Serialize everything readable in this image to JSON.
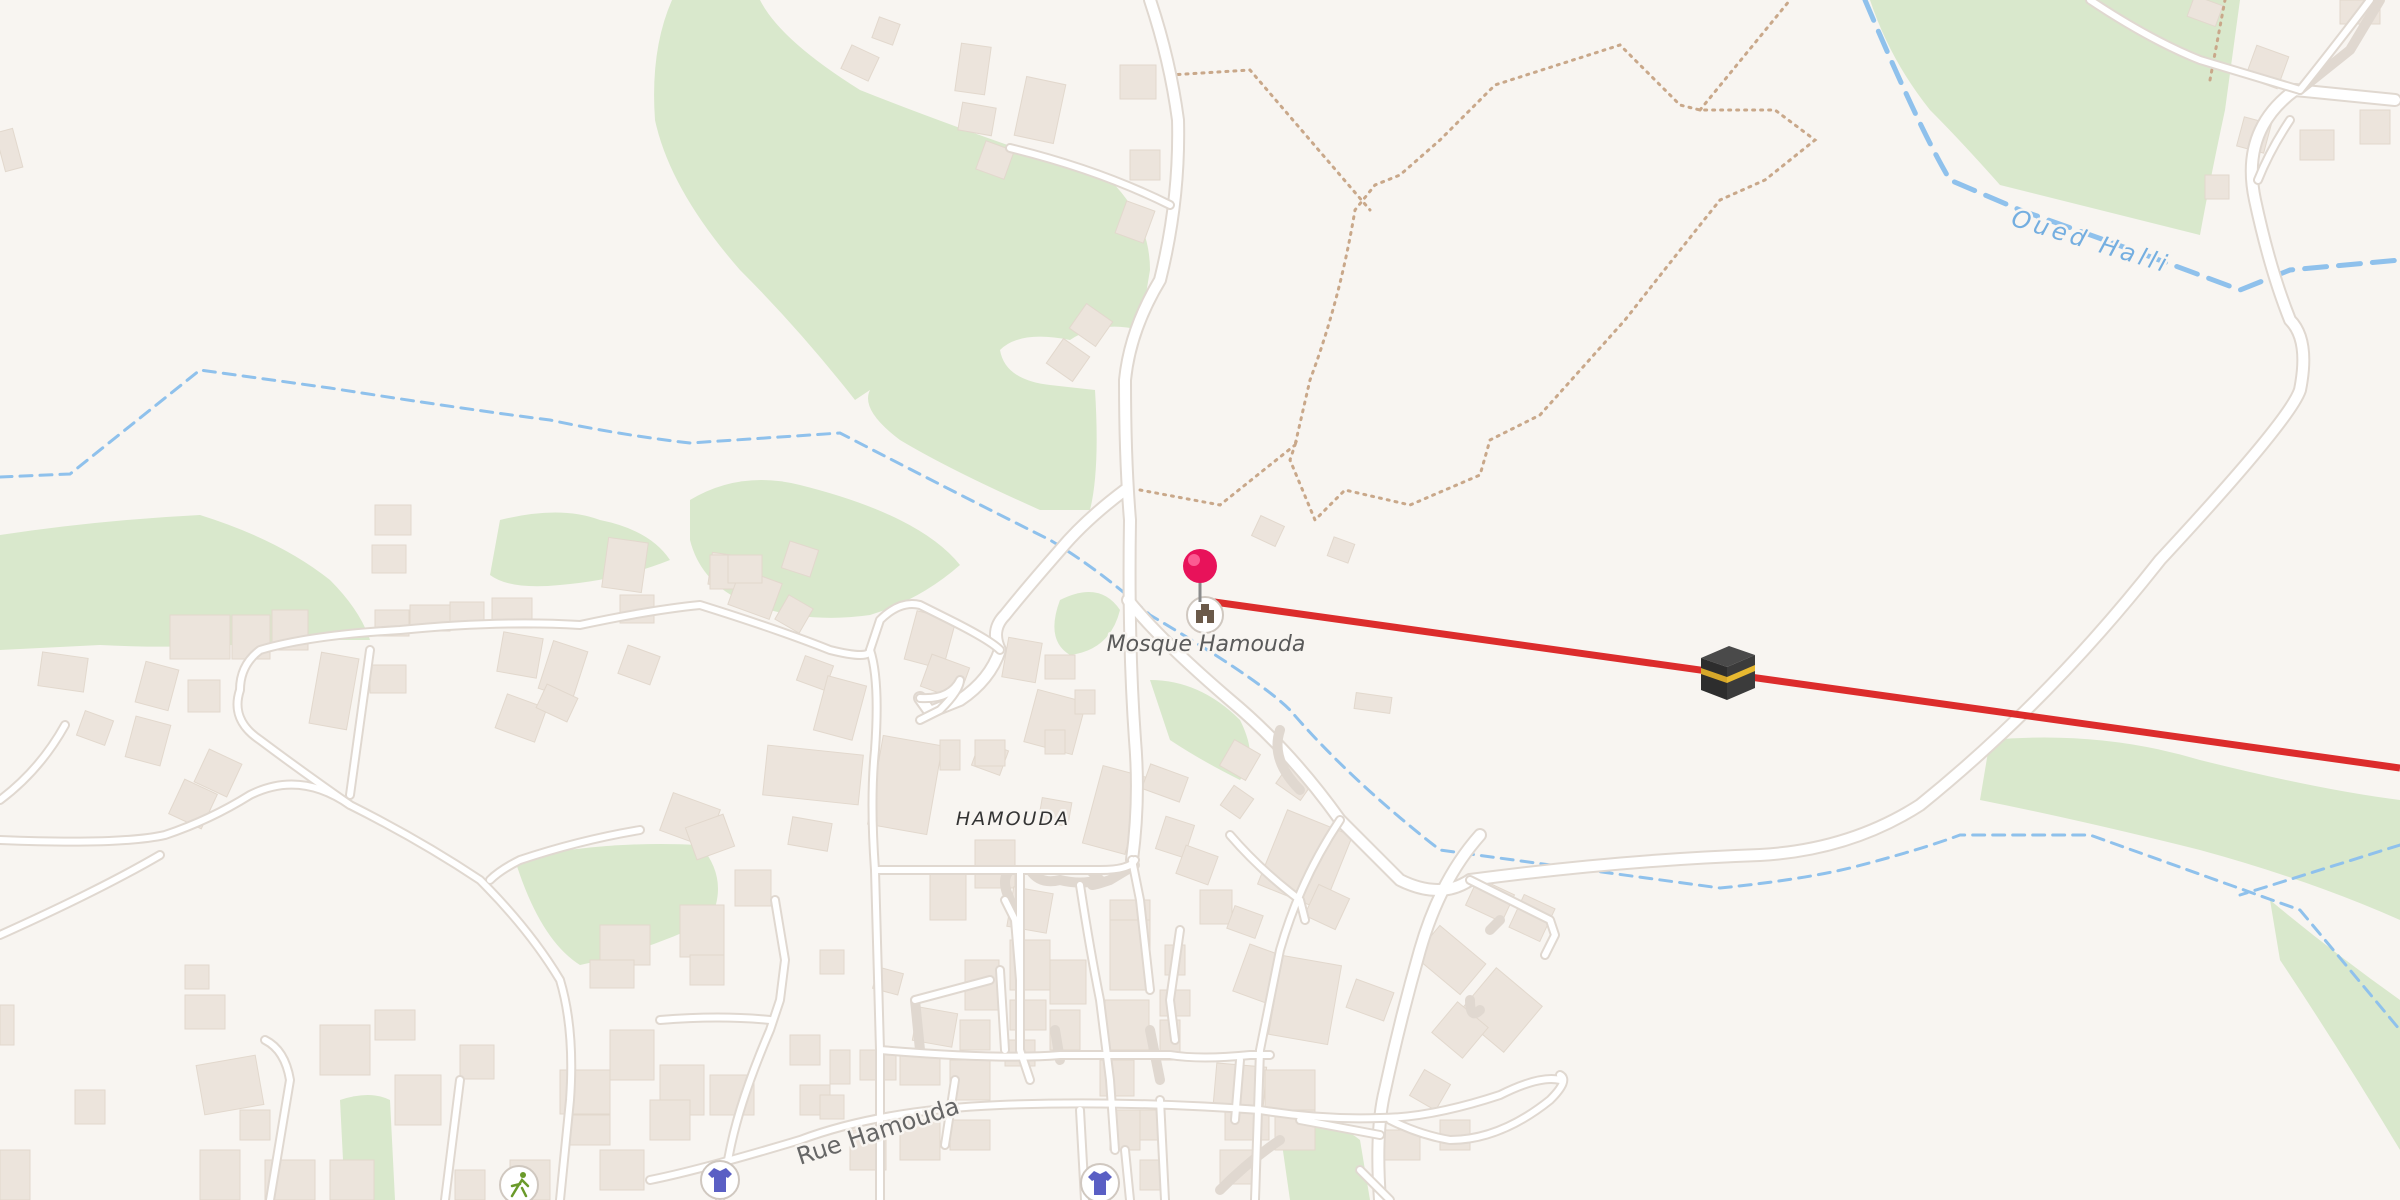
{
  "map": {
    "poi_label": "Mosque Hamouda",
    "poi_icon": "mosque-icon",
    "place_label": "HAMOUDA",
    "road_label": "Rue Hamouda",
    "waterway_label": "Oued Halli",
    "marker_icon": "location-pin-icon",
    "qibla_icon": "kaaba-icon",
    "line_description": "Qibla direction line",
    "poi_icons": [
      "clothing-shop-icon",
      "clothing-shop-icon",
      "sports-icon"
    ]
  },
  "colors": {
    "background": "#f8f5f1",
    "park": "#d9e8cc",
    "building": "#ece4dc",
    "road": "#ffffff",
    "water": "#8fc1ec",
    "trail": "#c9a88a",
    "qibla_line": "#dc2c2c",
    "marker": "#e8125a"
  }
}
